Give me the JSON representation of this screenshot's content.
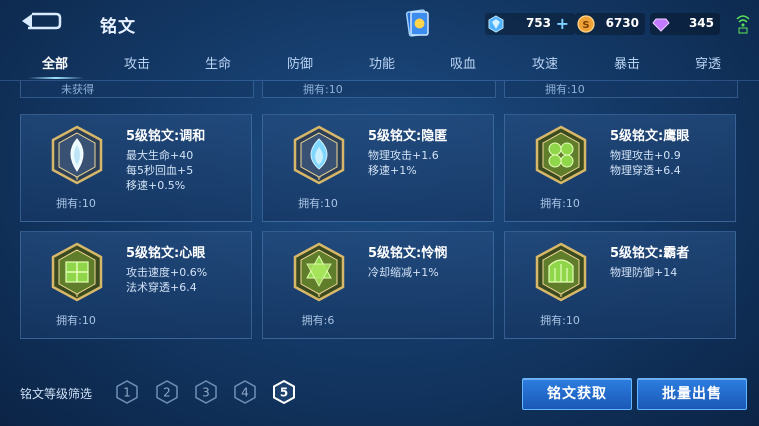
{
  "header": {
    "title": "铭文"
  },
  "currency": {
    "diamond": "753",
    "gold": "6730",
    "gem": "345"
  },
  "tabs": [
    {
      "label": "全部"
    },
    {
      "label": "攻击"
    },
    {
      "label": "生命"
    },
    {
      "label": "防御"
    },
    {
      "label": "功能"
    },
    {
      "label": "吸血"
    },
    {
      "label": "攻速"
    },
    {
      "label": "暴击"
    },
    {
      "label": "穿透"
    }
  ],
  "partial_row": [
    "未获得",
    "拥有:10",
    "拥有:10"
  ],
  "runes": [
    {
      "name": "5级铭文:调和",
      "attrs": [
        "最大生命+40",
        "每5秒回血+5",
        "移速+0.5%"
      ],
      "owned": "拥有:10",
      "icon": "harmony-rune-icon",
      "color": "#e9fbff"
    },
    {
      "name": "5级铭文:隐匿",
      "attrs": [
        "物理攻击+1.6",
        "移速+1%"
      ],
      "owned": "拥有:10",
      "icon": "stealth-rune-icon",
      "color": "#7fd6ff"
    },
    {
      "name": "5级铭文:鹰眼",
      "attrs": [
        "物理攻击+0.9",
        "物理穿透+6.4"
      ],
      "owned": "拥有:10",
      "icon": "hawkeye-rune-icon",
      "color": "#8fd64a"
    },
    {
      "name": "5级铭文:心眼",
      "attrs": [
        "攻击速度+0.6%",
        "法术穿透+6.4"
      ],
      "owned": "拥有:10",
      "icon": "mind-eye-rune-icon",
      "color": "#8fd64a"
    },
    {
      "name": "5级铭文:怜悯",
      "attrs": [
        "冷却缩减+1%"
      ],
      "owned": "拥有:6",
      "icon": "mercy-rune-icon",
      "color": "#8fd64a"
    },
    {
      "name": "5级铭文:霸者",
      "attrs": [
        "物理防御+14"
      ],
      "owned": "拥有:10",
      "icon": "overlord-rune-icon",
      "color": "#8fd64a"
    }
  ],
  "filter": {
    "label": "铭文等级筛选",
    "levels": [
      "1",
      "2",
      "3",
      "4",
      "5"
    ],
    "selected": "5"
  },
  "buttons": {
    "acquire": "铭文获取",
    "sell": "批量出售"
  }
}
